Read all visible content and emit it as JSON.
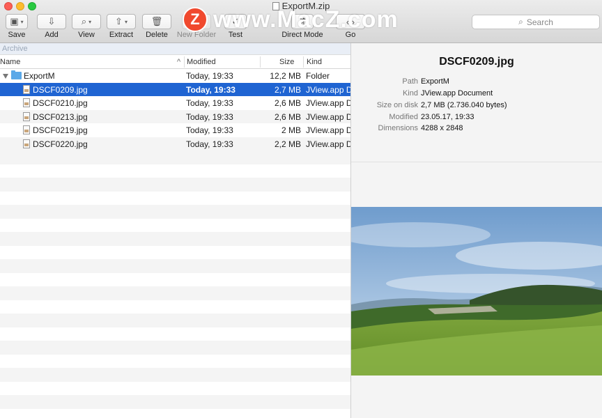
{
  "window": {
    "title": "ExportM.zip"
  },
  "toolbar": {
    "items": [
      {
        "label": "Save"
      },
      {
        "label": "Add"
      },
      {
        "label": "View"
      },
      {
        "label": "Extract"
      },
      {
        "label": "Delete"
      },
      {
        "label": "New Folder"
      },
      {
        "label": "Test"
      },
      {
        "label": "Direct Mode"
      },
      {
        "label": "Go"
      }
    ],
    "search_placeholder": "Search"
  },
  "watermark": {
    "logo": "Z",
    "text": "www.MacZ.com"
  },
  "archive_bar": "Archive",
  "columns": {
    "name": "Name",
    "modified": "Modified",
    "size": "Size",
    "kind": "Kind"
  },
  "rows": [
    {
      "name": "ExportM",
      "modified": "Today, 19:33",
      "size": "12,2 MB",
      "kind": "Folder",
      "type": "folder"
    },
    {
      "name": "DSCF0209.jpg",
      "modified": "Today, 19:33",
      "size": "2,7 MB",
      "kind": "JView.app D",
      "type": "file",
      "selected": true
    },
    {
      "name": "DSCF0210.jpg",
      "modified": "Today, 19:33",
      "size": "2,6 MB",
      "kind": "JView.app D",
      "type": "file"
    },
    {
      "name": "DSCF0213.jpg",
      "modified": "Today, 19:33",
      "size": "2,6 MB",
      "kind": "JView.app D",
      "type": "file"
    },
    {
      "name": "DSCF0219.jpg",
      "modified": "Today, 19:33",
      "size": "2 MB",
      "kind": "JView.app D",
      "type": "file"
    },
    {
      "name": "DSCF0220.jpg",
      "modified": "Today, 19:33",
      "size": "2,2 MB",
      "kind": "JView.app D",
      "type": "file"
    }
  ],
  "info": {
    "title": "DSCF0209.jpg",
    "fields": [
      {
        "key": "Path",
        "value": "ExportM"
      },
      {
        "key": "Kind",
        "value": "JView.app Document"
      },
      {
        "key": "Size on disk",
        "value": "2,7 MB (2.736.040 bytes)"
      },
      {
        "key": "Modified",
        "value": "23.05.17, 19:33"
      },
      {
        "key": "Dimensions",
        "value": "4288 x 2848"
      }
    ]
  },
  "colors": {
    "selection": "#1f64d2",
    "folder": "#5aa8e8",
    "watermark_logo": "#f0492e"
  }
}
